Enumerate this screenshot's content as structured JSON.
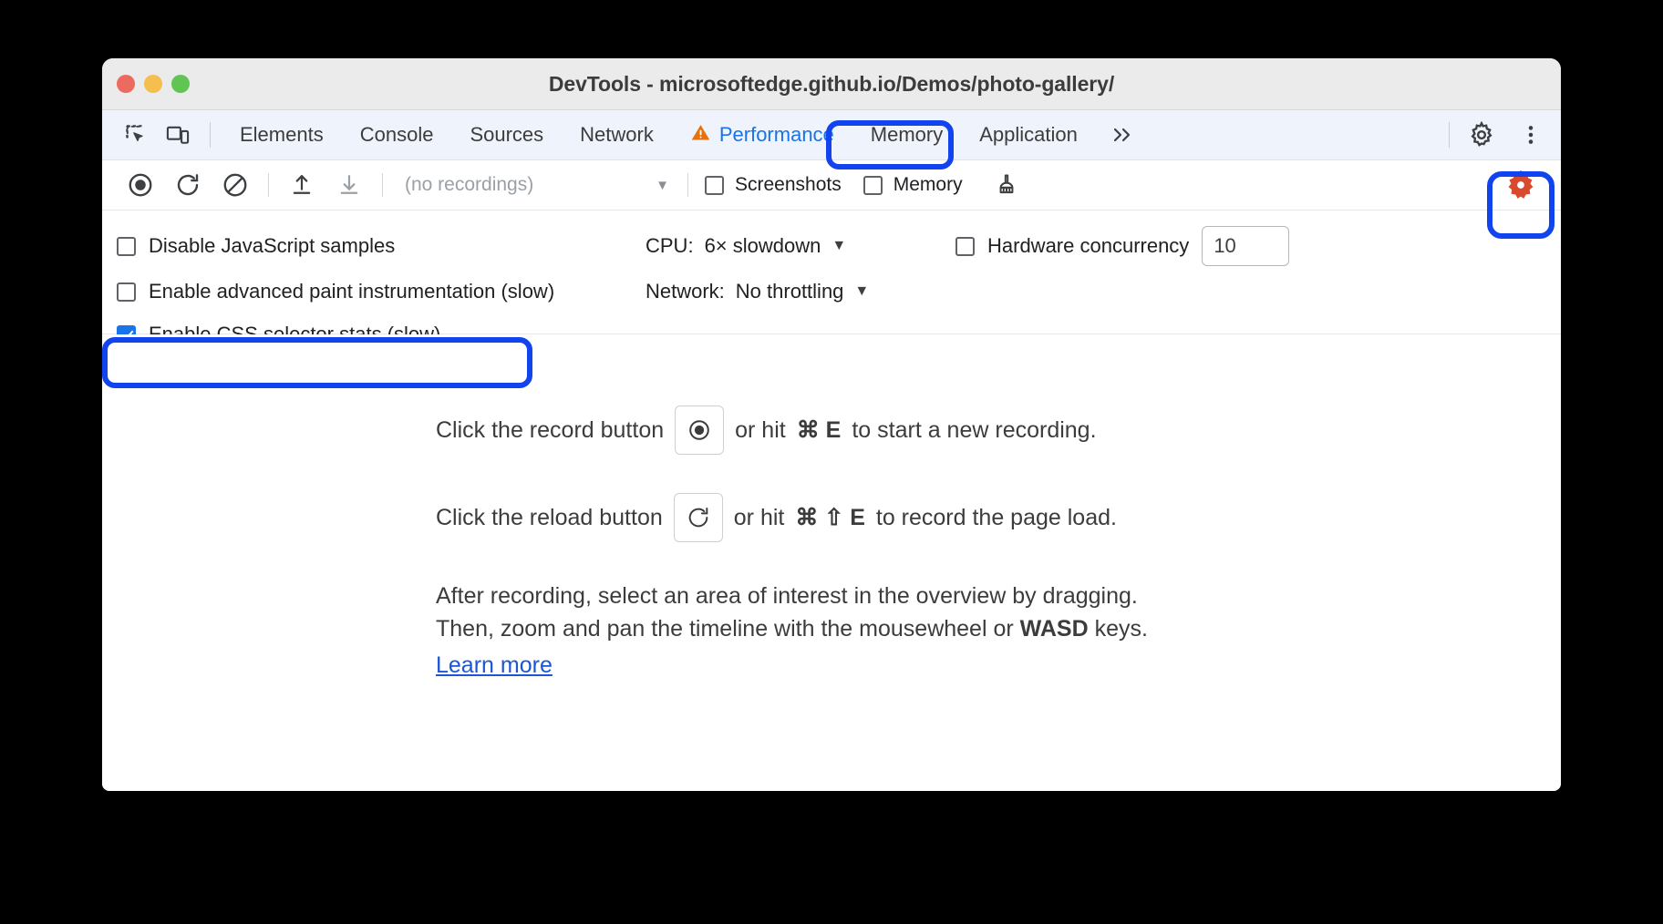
{
  "window": {
    "title": "DevTools - microsoftedge.github.io/Demos/photo-gallery/",
    "traffic_lights": [
      "close",
      "minimize",
      "zoom"
    ],
    "colors": {
      "close": "#ed6a5e",
      "minimize": "#f4bf4f",
      "zoom": "#61c554",
      "accent_blue": "#1a73e8",
      "highlight_blue": "#1144ee",
      "warning_orange": "#e8710a",
      "active_gear_red": "#d93025",
      "link_blue": "#1a56d6"
    }
  },
  "tabbar": {
    "left_icons": [
      {
        "name": "inspect-element-icon",
        "label": "Inspect element"
      },
      {
        "name": "device-toolbar-icon",
        "label": "Toggle device toolbar"
      }
    ],
    "tabs": [
      {
        "label": "Elements",
        "active": false
      },
      {
        "label": "Console",
        "active": false
      },
      {
        "label": "Sources",
        "active": false
      },
      {
        "label": "Network",
        "active": false
      },
      {
        "label": "Performance",
        "active": true,
        "warning_icon": "warning-triangle-icon"
      },
      {
        "label": "Memory",
        "active": false
      },
      {
        "label": "Application",
        "active": false
      }
    ],
    "more_tabs_label": "»",
    "settings_icon": "gear-icon",
    "more_options_icon": "kebab-menu-icon"
  },
  "rec_toolbar": {
    "buttons": [
      {
        "name": "record-button",
        "icon": "record-circle-icon"
      },
      {
        "name": "reload-and-record-button",
        "icon": "reload-icon"
      },
      {
        "name": "clear-button",
        "icon": "clear-slash-icon"
      },
      {
        "name": "load-profile-button",
        "icon": "upload-arrow-icon"
      },
      {
        "name": "save-profile-button",
        "icon": "download-arrow-icon"
      }
    ],
    "recordings_value": "(no recordings)",
    "screenshots": {
      "label": "Screenshots",
      "checked": false
    },
    "memory": {
      "label": "Memory",
      "checked": false
    },
    "gc_icon": "broom-icon",
    "capture_settings_icon": "gear-icon-active"
  },
  "settings": {
    "disable_js_samples": {
      "label": "Disable JavaScript samples",
      "checked": false
    },
    "advanced_paint": {
      "label": "Enable advanced paint instrumentation (slow)",
      "checked": false
    },
    "css_selector_stats": {
      "label": "Enable CSS selector stats (slow)",
      "checked": true
    },
    "cpu": {
      "label": "CPU:",
      "value": "6× slowdown"
    },
    "network": {
      "label": "Network:",
      "value": "No throttling"
    },
    "hardware_concurrency": {
      "label": "Hardware concurrency",
      "checked": false,
      "value": "10"
    }
  },
  "main": {
    "record_line": {
      "prefix": "Click the record button",
      "suffix_before_keys": "or hit",
      "keys": "⌘ E",
      "suffix": "to start a new recording.",
      "icon": "record-circle-icon"
    },
    "reload_line": {
      "prefix": "Click the reload button",
      "suffix_before_keys": "or hit",
      "keys": "⌘ ⇧ E",
      "suffix": "to record the page load.",
      "icon": "reload-icon"
    },
    "paragraph_line1": "After recording, select an area of interest in the overview by dragging.",
    "paragraph_line2_a": "Then, zoom and pan the timeline with the mousewheel or ",
    "paragraph_line2_b": "WASD",
    "paragraph_line2_c": " keys.",
    "learn_more": "Learn more"
  },
  "annotations": [
    {
      "name": "highlight-performance-tab",
      "target": "Performance tab"
    },
    {
      "name": "highlight-capture-settings-gear",
      "target": "Capture settings gear"
    },
    {
      "name": "highlight-css-selector-stats",
      "target": "Enable CSS selector stats (slow)"
    }
  ]
}
